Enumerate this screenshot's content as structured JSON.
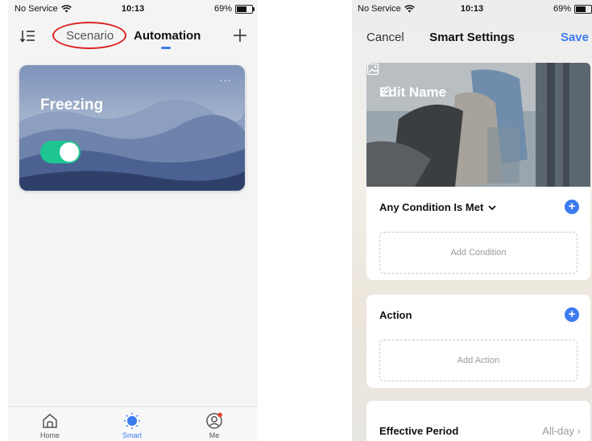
{
  "left": {
    "status": {
      "carrier": "No Service",
      "time": "10:13",
      "battery": "69%",
      "battery_level": 0.69
    },
    "topbar": {
      "tab_scenario": "Scenario",
      "tab_automation": "Automation"
    },
    "card": {
      "title": "Freezing",
      "more": "···",
      "toggle_on": true
    },
    "tabbar": {
      "home": "Home",
      "smart": "Smart",
      "me": "Me"
    },
    "colors": {
      "accent": "#3c7bf0",
      "toggle": "#1ec592",
      "annotation": "#dd2222"
    }
  },
  "right": {
    "status": {
      "carrier": "No Service",
      "time": "10:13",
      "battery": "69%",
      "battery_level": 0.69
    },
    "nav": {
      "cancel": "Cancel",
      "title": "Smart Settings",
      "save": "Save"
    },
    "photo": {
      "edit_name": "Edit Name"
    },
    "condition": {
      "header": "Any Condition Is Met",
      "add_label": "Add Condition"
    },
    "action": {
      "header": "Action",
      "add_label": "Add Action"
    },
    "period": {
      "label": "Effective Period",
      "value": "All-day"
    }
  }
}
